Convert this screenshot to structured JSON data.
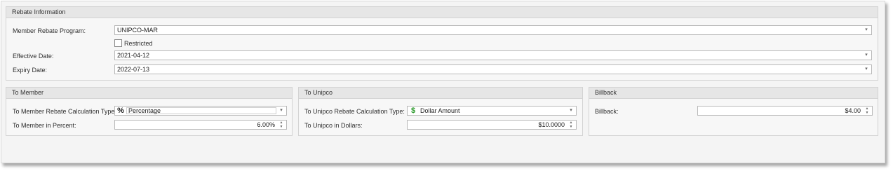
{
  "rebate_info": {
    "header": "Rebate Information",
    "member_program": {
      "label": "Member Rebate Program:",
      "value": "UNIPCO-MAR"
    },
    "restricted": {
      "label": "Restricted",
      "checked": false
    },
    "effective_date": {
      "label": "Effective Date:",
      "value": "2021-04-12"
    },
    "expiry_date": {
      "label": "Expiry Date:",
      "value": "2022-07-13"
    }
  },
  "to_member": {
    "header": "To Member",
    "calc_type": {
      "label": "To Member Rebate Calculation Type:",
      "value": "Percentage",
      "icon": "percent-icon"
    },
    "percent": {
      "label": "To Member in Percent:",
      "value": "6.00%"
    }
  },
  "to_unipco": {
    "header": "To Unipco",
    "calc_type": {
      "label": "To Unipco Rebate Calculation Type:",
      "value": "Dollar Amount",
      "icon": "dollar-icon",
      "icon_color": "#2d9b2d"
    },
    "dollars": {
      "label": "To Unipco in Dollars:",
      "value": "$10.0000"
    }
  },
  "billback": {
    "header": "Billback",
    "field": {
      "label": "Billback:",
      "value": "$4.00"
    }
  },
  "glyphs": {
    "dropdown": "▾",
    "spin_up": "▲",
    "spin_down": "▼",
    "percent": "%",
    "dollar": "$"
  }
}
